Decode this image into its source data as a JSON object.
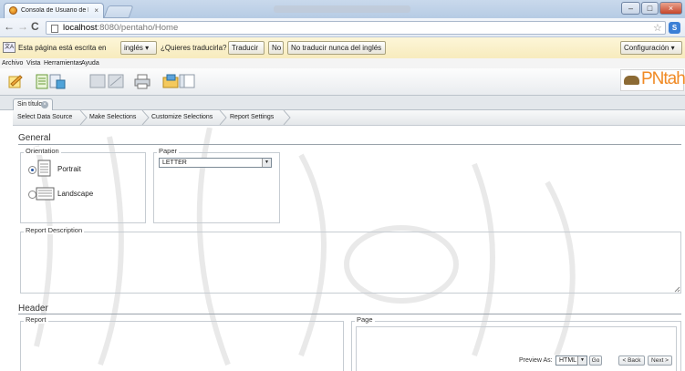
{
  "browser": {
    "tab_title": "Consola de Usuario de Pen",
    "tab_close": "×",
    "window_buttons": {
      "minimize": "–",
      "maximize": "□",
      "close": "×"
    },
    "url_host": "localhost",
    "url_path": ":8080/pentaho/Home",
    "star": "☆",
    "wrench": "S"
  },
  "translate_bar": {
    "icon_text": "文A",
    "prefix": "Esta página está escrita en",
    "language": "inglés",
    "question": "¿Quieres traducirla?",
    "translate_btn": "Traducir",
    "no_btn": "No",
    "never_btn": "No traducir nunca del inglés",
    "config_btn": "Configuración"
  },
  "menu": [
    "Archivo",
    "Vista",
    "Herramientas",
    "Ayuda"
  ],
  "toolbar_icons": [
    "new-report-icon",
    "open-report-icon",
    "save-icon",
    "save-as-icon",
    "print-icon",
    "folder-icon",
    "toggle-panel-icon"
  ],
  "logo_text": "PNtaho",
  "doc_tab": {
    "label": "Sin título",
    "close": "×"
  },
  "wizard_steps": [
    "Select Data Source",
    "Make Selections",
    "Customize Selections",
    "Report Settings"
  ],
  "general": {
    "title": "General",
    "orientation_label": "Orientation",
    "portrait": "Portrait",
    "landscape": "Landscape",
    "selected_orientation": "Portrait",
    "paper_label": "Paper",
    "paper_value": "LETTER",
    "description_label": "Report Description"
  },
  "header": {
    "title": "Header",
    "report_label": "Report",
    "page_label": "Page"
  },
  "footer_bar": {
    "preview_label": "Preview As:",
    "preview_value": "HTML",
    "go": "Go",
    "back": "< Back",
    "next": "Next >"
  },
  "colors": {
    "accent": "#f08a24",
    "translate_bar": "#f7ebbd",
    "title_bar": "#b6cbe4"
  }
}
